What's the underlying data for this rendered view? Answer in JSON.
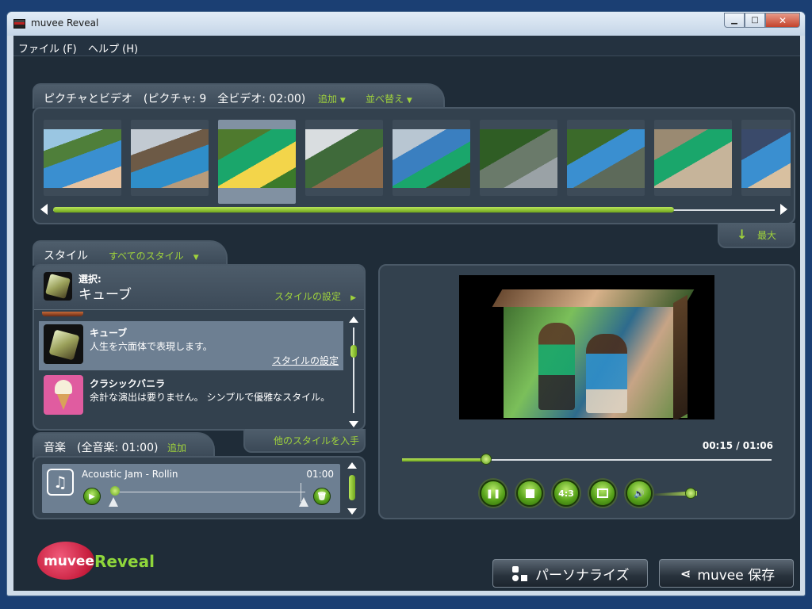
{
  "window": {
    "title": "muvee Reveal",
    "minimize": "▁",
    "maximize": "□",
    "close": "✕"
  },
  "menu": {
    "file": "ファイル (F)",
    "help": "ヘルプ (H)"
  },
  "pictures": {
    "title": "ピクチャとビデオ　(ピクチャ: 9　全ビデオ: 02:00)",
    "add": "追加",
    "sort": "並べ替え",
    "thumb_count": 9,
    "selected_index": 2,
    "scroll_position": 0.86,
    "maximize_label": "最大"
  },
  "styles": {
    "tab_title": "スタイル",
    "all_styles": "すべてのスタイル",
    "selected_label": "選択:",
    "selected_name": "キューブ",
    "settings_link": "スタイルの設定",
    "items": [
      {
        "name": "キューブ",
        "desc": "人生を六面体で表現します。",
        "link": "スタイルの設定"
      },
      {
        "name": "クラシックバニラ",
        "desc": "余計な演出は要りません。 シンプルで優雅なスタイル。"
      }
    ],
    "get_more": "他のスタイルを入手"
  },
  "music": {
    "title": "音楽　(全音楽: 01:00)",
    "add": "追加",
    "track_name": "Acoustic Jam - Rollin",
    "track_duration": "01:00"
  },
  "preview": {
    "time": "00:15 / 01:06",
    "progress": 0.227,
    "volume": 0.85,
    "aspect_label": "4:3"
  },
  "buttons": {
    "personalize": "パーソナライズ",
    "save": "muvee 保存"
  },
  "logo": {
    "part1": "muvee",
    "part2": "Reveal"
  },
  "colors": {
    "accent_green": "#9fd23c",
    "panel": "#33414e",
    "background": "#1f2c38"
  }
}
